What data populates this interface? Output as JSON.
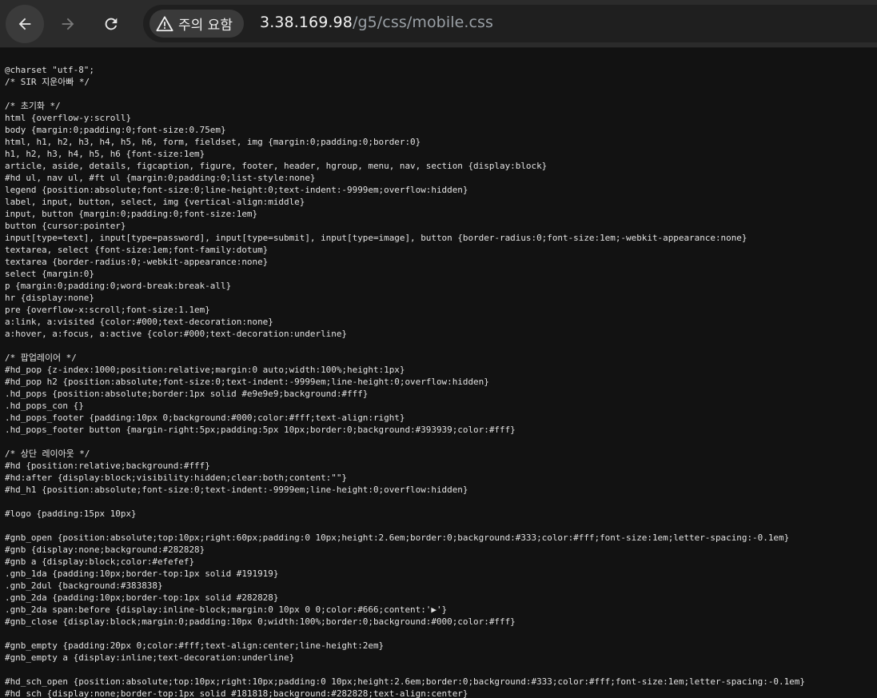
{
  "browser": {
    "back_icon": "arrow-left-icon",
    "forward_icon": "arrow-right-icon",
    "reload_icon": "reload-icon",
    "security_icon": "warning-triangle-icon",
    "security_label": "주의 요함",
    "url_host": "3.38.169.98",
    "url_path": "/g5/css/mobile.css"
  },
  "document": {
    "lines": [
      "@charset \"utf-8\";",
      "/* SIR 지운아빠 */",
      "",
      "/* 초기화 */",
      "html {overflow-y:scroll}",
      "body {margin:0;padding:0;font-size:0.75em}",
      "html, h1, h2, h3, h4, h5, h6, form, fieldset, img {margin:0;padding:0;border:0}",
      "h1, h2, h3, h4, h5, h6 {font-size:1em}",
      "article, aside, details, figcaption, figure, footer, header, hgroup, menu, nav, section {display:block}",
      "#hd ul, nav ul, #ft ul {margin:0;padding:0;list-style:none}",
      "legend {position:absolute;font-size:0;line-height:0;text-indent:-9999em;overflow:hidden}",
      "label, input, button, select, img {vertical-align:middle}",
      "input, button {margin:0;padding:0;font-size:1em}",
      "button {cursor:pointer}",
      "input[type=text], input[type=password], input[type=submit], input[type=image], button {border-radius:0;font-size:1em;-webkit-appearance:none}",
      "textarea, select {font-size:1em;font-family:dotum}",
      "textarea {border-radius:0;-webkit-appearance:none}",
      "select {margin:0}",
      "p {margin:0;padding:0;word-break:break-all}",
      "hr {display:none}",
      "pre {overflow-x:scroll;font-size:1.1em}",
      "a:link, a:visited {color:#000;text-decoration:none}",
      "a:hover, a:focus, a:active {color:#000;text-decoration:underline}",
      "",
      "/* 팝업레이어 */",
      "#hd_pop {z-index:1000;position:relative;margin:0 auto;width:100%;height:1px}",
      "#hd_pop h2 {position:absolute;font-size:0;text-indent:-9999em;line-height:0;overflow:hidden}",
      ".hd_pops {position:absolute;border:1px solid #e9e9e9;background:#fff}",
      ".hd_pops_con {}",
      ".hd_pops_footer {padding:10px 0;background:#000;color:#fff;text-align:right}",
      ".hd_pops_footer button {margin-right:5px;padding:5px 10px;border:0;background:#393939;color:#fff}",
      "",
      "/* 상단 레이아웃 */",
      "#hd {position:relative;background:#fff}",
      "#hd:after {display:block;visibility:hidden;clear:both;content:\"\"}",
      "#hd_h1 {position:absolute;font-size:0;text-indent:-9999em;line-height:0;overflow:hidden}",
      "",
      "#logo {padding:15px 10px}",
      "",
      "#gnb_open {position:absolute;top:10px;right:60px;padding:0 10px;height:2.6em;border:0;background:#333;color:#fff;font-size:1em;letter-spacing:-0.1em}",
      "#gnb {display:none;background:#282828}",
      "#gnb a {display:block;color:#efefef}",
      ".gnb_1da {padding:10px;border-top:1px solid #191919}",
      ".gnb_2dul {background:#383838}",
      ".gnb_2da {padding:10px;border-top:1px solid #282828}",
      ".gnb_2da span:before {display:inline-block;margin:0 10px 0 0;color:#666;content:'▶'}",
      "#gnb_close {display:block;margin:0;padding:10px 0;width:100%;border:0;background:#000;color:#fff}",
      "",
      "#gnb_empty {padding:20px 0;color:#fff;text-align:center;line-height:2em}",
      "#gnb_empty a {display:inline;text-decoration:underline}",
      "",
      "#hd_sch_open {position:absolute;top:10px;right:10px;padding:0 10px;height:2.6em;border:0;background:#333;color:#fff;font-size:1em;letter-spacing:-0.1em}",
      "#hd_sch {display:none;border-top:1px solid #181818;background:#282828;text-align:center}"
    ]
  }
}
